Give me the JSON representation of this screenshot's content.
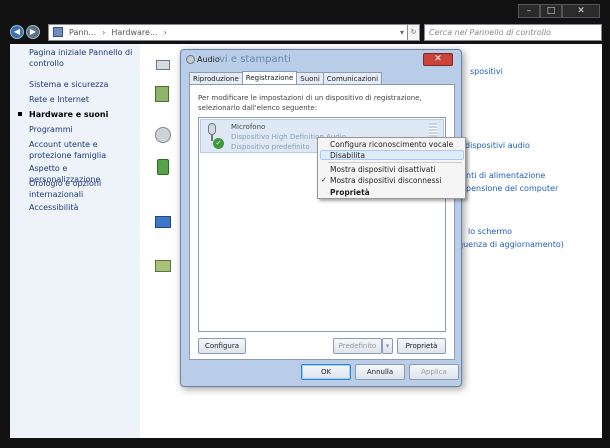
{
  "window": {
    "buttons": {
      "minimize": "–",
      "maximize": "□",
      "close": "✕"
    }
  },
  "address": {
    "crumbs": [
      "Pann...",
      "Hardware...",
      "›"
    ],
    "search_placeholder": "Cerca nel Pannello di controllo"
  },
  "sidebar": {
    "items": [
      {
        "label": "Pagina iniziale Pannello di controllo"
      },
      {
        "label": "Sistema e sicurezza"
      },
      {
        "label": "Rete e Internet"
      },
      {
        "label": "Hardware e suoni"
      },
      {
        "label": "Programmi"
      },
      {
        "label": "Account utente e protezione famiglia"
      },
      {
        "label": "Aspetto e personalizzazione"
      },
      {
        "label": "Orologio e opzioni internazionali"
      },
      {
        "label": "Accessibilità"
      }
    ]
  },
  "main": {
    "links": [
      "dispositivi audio",
      "nti di alimentazione",
      "pensione del computer",
      "lo schermo",
      "quenza di aggiornamento)",
      "spositivi"
    ]
  },
  "dialog": {
    "title": "Audio",
    "ghost_title": "vi e stampanti",
    "close": "✕",
    "tabs": [
      "Riproduzione",
      "Registrazione",
      "Suoni",
      "Comunicazioni"
    ],
    "description": "Per modificare le impostazioni di un dispositivo di registrazione, selezionarlo dall'elenco seguente:",
    "device": {
      "name": "Microfono",
      "driver": "Dispositivo High Definition Audio",
      "status": "Dispositivo predefinito"
    },
    "buttons": {
      "configure": "Configura",
      "default": "Predefinito",
      "properties": "Proprietà",
      "ok": "OK",
      "cancel": "Annulla",
      "apply": "Applica"
    }
  },
  "context_menu": {
    "items": [
      "Configura riconoscimento vocale",
      "Disabilita",
      "Mostra dispositivi disattivati",
      "Mostra dispositivi disconnessi",
      "Proprietà"
    ]
  }
}
